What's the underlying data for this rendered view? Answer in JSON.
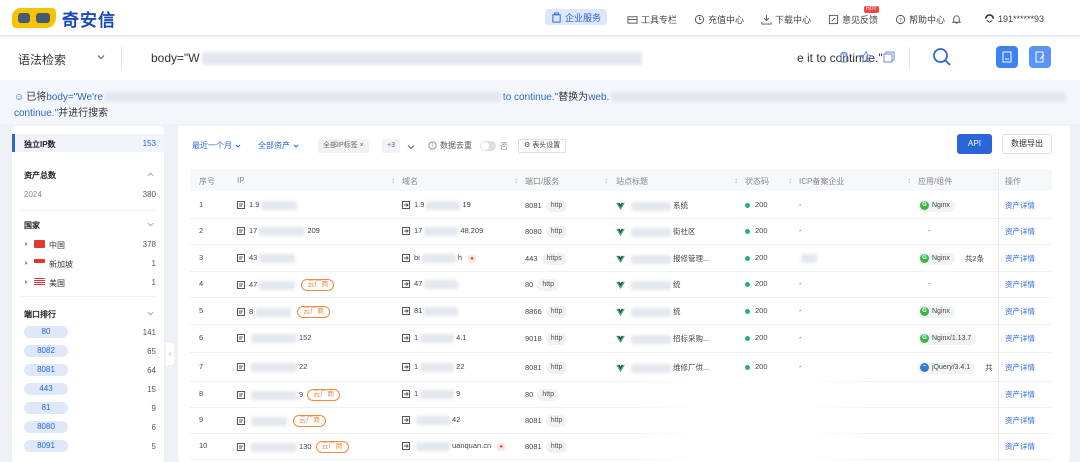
{
  "brand": {
    "logo_text": "奇安信"
  },
  "nav": {
    "enterprise": "企业服务",
    "tools": "工具专栏",
    "recharge": "充值中心",
    "download": "下载中心",
    "feedback": "意见反馈",
    "feedback_badge": "HOT",
    "help": "帮助中心",
    "user": "191******93"
  },
  "search": {
    "syntax_label": "语法检索",
    "query_prefix": "body=\"W",
    "query_suffix": "e it to continue.\""
  },
  "notice": {
    "prefix": "已将",
    "from_part": "body=\"We're",
    "from_tail": "to continue.\"",
    "replace_word": "替换为",
    "to_part": "web.",
    "line2_blue": "continue.\"",
    "line2_tail": "并进行搜索"
  },
  "sidebar": {
    "unique_ip_label": "独立IP数",
    "unique_ip_count": "153",
    "assets_label": "资产总数",
    "assets_year": "2024",
    "assets_count": "380",
    "country_label": "国家",
    "countries": [
      {
        "name": "中国",
        "count": "378"
      },
      {
        "name": "新加坡",
        "count": "1"
      },
      {
        "name": "美国",
        "count": "1"
      }
    ],
    "port_label": "端口排行",
    "ports": [
      {
        "port": "80",
        "count": "141"
      },
      {
        "port": "8082",
        "count": "65"
      },
      {
        "port": "8081",
        "count": "64"
      },
      {
        "port": "443",
        "count": "15"
      },
      {
        "port": "81",
        "count": "9"
      },
      {
        "port": "8080",
        "count": "6"
      },
      {
        "port": "8091",
        "count": "5"
      }
    ]
  },
  "toolbar": {
    "time_filter": "最近一个月",
    "asset_filter": "全部资产",
    "ip_tag": "全部IP标签",
    "more_count": "+3",
    "dedupe_label": "数据去重",
    "dedupe_value": "否",
    "columns_btn": "表头设置",
    "api_btn": "API",
    "export_btn": "数据导出"
  },
  "table": {
    "headers": {
      "index": "序号",
      "ip": "IP",
      "domain": "域名",
      "port": "端口/服务",
      "title": "站点标题",
      "status": "状态码",
      "icp": "ICP备案企业",
      "app": "应用/组件",
      "op": "操作"
    },
    "rows": [
      {
        "index": "1",
        "ip": "1.9",
        "cloud": "",
        "domain": "1.9",
        "domain_tail": "19",
        "port": "8081",
        "service": "http",
        "title": "后",
        "title_tail": "系统",
        "status": "200",
        "icp": "-",
        "app": "Nginx",
        "app_kind": "G",
        "app_extra": "",
        "action": "资产详情"
      },
      {
        "index": "2",
        "ip": "17",
        "ip_tail": "209",
        "cloud": "",
        "domain": "17",
        "domain_tail": "48.209",
        "port": "8080",
        "service": "http",
        "title": "",
        "title_tail": "街社区",
        "status": "200",
        "icp": "-",
        "app": "",
        "app_kind": "",
        "app_extra": "-",
        "action": "资产详情"
      },
      {
        "index": "3",
        "ip": "43",
        "cloud": "",
        "domain": "bi",
        "domain_tail": "h",
        "port": "443",
        "service": "https",
        "title": "",
        "title_tail": "报修管理...",
        "status": "200",
        "icp": "",
        "app": "Nginx",
        "app_kind": "G",
        "app_extra": "共2条",
        "action": "资产详情"
      },
      {
        "index": "4",
        "ip": "47",
        "cloud": "云厂商",
        "domain": "47",
        "domain_tail": "",
        "port": "80",
        "service": "http",
        "title": "",
        "title_tail": "统",
        "status": "200",
        "icp": "-",
        "app": "",
        "app_kind": "",
        "app_extra": "-",
        "action": "资产详情"
      },
      {
        "index": "5",
        "ip": "8",
        "cloud": "云厂商",
        "domain": "81",
        "domain_tail": "",
        "port": "8866",
        "service": "http",
        "title": "",
        "title_tail": "统",
        "status": "200",
        "icp": "-",
        "app": "Nginx",
        "app_kind": "G",
        "app_extra": "",
        "action": "资产详情"
      },
      {
        "index": "6",
        "ip": "",
        "ip_tail": "152",
        "cloud": "",
        "domain": "1",
        "domain_tail": "4.1",
        "port": "9018",
        "service": "http",
        "title": "",
        "title_tail": "招标采购...",
        "status": "200",
        "icp": "-",
        "app": "Nginx/1.13.7",
        "app_kind": "G",
        "app_extra": "",
        "action": "资产详情"
      },
      {
        "index": "7",
        "ip": "",
        "ip_tail": "22",
        "cloud": "",
        "domain": "1",
        "domain_tail": "22",
        "port": "8081",
        "service": "http",
        "title": "",
        "title_tail": "维修厂供...",
        "status": "200",
        "icp": "-",
        "app": "jQuery/3.4.1",
        "app_kind": "jQ",
        "app_extra": "共",
        "action": "资产详情"
      },
      {
        "index": "8",
        "ip": "",
        "ip_tail": "9",
        "cloud": "云厂商",
        "domain": "1",
        "domain_tail": "9",
        "port": "80",
        "service": "http",
        "title": "",
        "title_tail": "",
        "status": "",
        "icp": "",
        "app": "",
        "app_kind": "",
        "app_extra": "",
        "action": "资产详情"
      },
      {
        "index": "9",
        "ip": "",
        "ip_tail": "",
        "cloud": "云厂商",
        "domain": "",
        "domain_tail": "42",
        "port": "8081",
        "service": "http",
        "title": "",
        "title_tail": "",
        "status": "",
        "icp": "",
        "app": "",
        "app_kind": "",
        "app_extra": "",
        "action": "资产详情"
      },
      {
        "index": "10",
        "ip": "",
        "ip_tail": "130",
        "cloud": "云厂商",
        "domain": "",
        "domain_tail": "uanquan.cn",
        "port": "8081",
        "service": "http",
        "title": "",
        "title_tail": "",
        "status": "",
        "icp": "",
        "app": "",
        "app_kind": "",
        "app_extra": "",
        "action": "资产详情"
      }
    ]
  },
  "colors": {
    "accent": "#2b66d9",
    "cloud": "#f08a40",
    "status_ok": "#27b36a"
  }
}
